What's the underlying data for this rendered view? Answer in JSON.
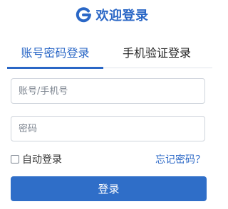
{
  "header": {
    "title": "欢迎登录",
    "logo_icon": "brand-g-logo-icon",
    "brand_color": "#2a67c6"
  },
  "tabs": [
    {
      "label": "账号密码登录",
      "active": true
    },
    {
      "label": "手机验证登录",
      "active": false
    }
  ],
  "form": {
    "username": {
      "placeholder": "账号/手机号",
      "value": ""
    },
    "password": {
      "placeholder": "密码",
      "value": ""
    },
    "auto_login": {
      "label": "自动登录",
      "checked": false
    },
    "forgot_password_label": "忘记密码？",
    "submit_label": "登录"
  }
}
